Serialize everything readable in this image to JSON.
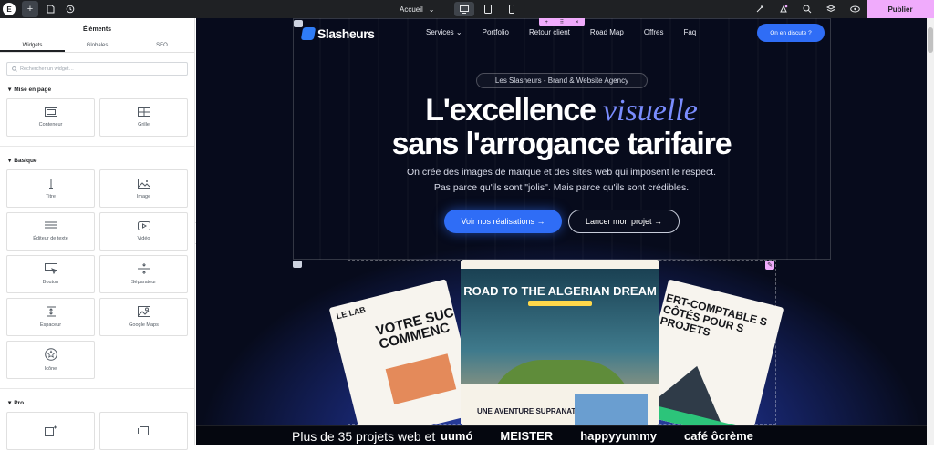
{
  "topbar": {
    "logo": "E",
    "page_name": "Accueil",
    "publish_label": "Publier"
  },
  "panel": {
    "title": "Éléments",
    "tabs": [
      "Widgets",
      "Globales",
      "SEO"
    ],
    "search_placeholder": "Rechercher un widget…",
    "categories": [
      {
        "name": "Mise en page",
        "widgets": [
          "Conteneur",
          "Grille"
        ]
      },
      {
        "name": "Basique",
        "widgets": [
          "Titre",
          "Image",
          "Éditeur de texte",
          "Vidéo",
          "Bouton",
          "Séparateur",
          "Espaceur",
          "Google Maps",
          "Icône"
        ]
      },
      {
        "name": "Pro",
        "widgets": [
          "",
          ""
        ]
      }
    ]
  },
  "site": {
    "brand": "Slasheurs",
    "nav": [
      "Services",
      "Portfolio",
      "Retour client",
      "Road Map",
      "Offres",
      "Faq"
    ],
    "cta": "On en discute ?",
    "pill": "Les Slasheurs - Brand & Website Agency",
    "headline_1a": "L'excellence ",
    "headline_1b": "visuelle",
    "headline_2": "sans l'arrogance tarifaire",
    "sub_1": "On crée des images de marque et des sites web qui imposent le respect.",
    "sub_2": "Pas parce qu'ils sont \"jolis\". Mais parce qu'ils sont crédibles.",
    "btn_primary": "Voir nos réalisations →",
    "btn_secondary": "Lancer mon projet →",
    "mock_center_title": "ROAD TO THE ALGERIAN DREAM",
    "mock_center_sub": "UNE AVENTURE SUPRANATIONALE",
    "mock_left_logo": "LE LAB",
    "mock_left_title": "VOTRE SUC COMMENC",
    "mock_right_title": "ERT-COMPTABLE S CÔTÉS POUR S PROJETS",
    "bottom_text": "Plus de 35 projets web et",
    "bottom_logos": [
      "uumó",
      "MEISTER",
      "happyyummy",
      "café ôcrème"
    ]
  }
}
